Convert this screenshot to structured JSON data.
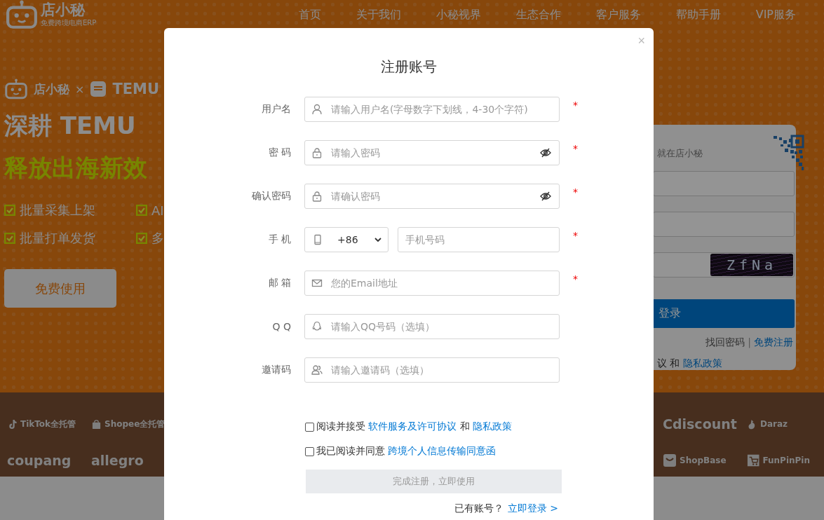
{
  "header": {
    "logo": {
      "name": "店小秘",
      "tagline": "免费跨境电商ERP"
    },
    "nav": [
      {
        "label": "首页"
      },
      {
        "label": "关于我们"
      },
      {
        "label": "小秘视界"
      },
      {
        "label": "生态合作"
      },
      {
        "label": "客户服务"
      },
      {
        "label": "帮助手册"
      },
      {
        "label": "VIP服务"
      }
    ]
  },
  "hero": {
    "brand": "店小秘",
    "cross": "×",
    "partner": "TEMU",
    "headline": "深耕 TEMU",
    "subheadline": "释放出海新效",
    "features": [
      {
        "label": "批量采集上架",
        "checked": true
      },
      {
        "label": "AI",
        "checked": true
      },
      {
        "label": "批量打单发货",
        "checked": true
      },
      {
        "label": "多",
        "checked": true
      }
    ],
    "primary_button": "免费使用"
  },
  "login_card": {
    "slogan": "就在店小秘",
    "captcha": "ZfNa",
    "login_button": "登录",
    "forgot_link": "找回密码",
    "separator": "|",
    "register_link": "免费注册",
    "agreement_text": "议 和",
    "privacy_link": "隐私政策"
  },
  "platforms": [
    {
      "kind": "tiktok",
      "name": "TikTok全托管"
    },
    {
      "kind": "shopee",
      "name": "Shopee全托管"
    },
    {
      "kind": "cdiscount",
      "name": "Cdiscount"
    },
    {
      "kind": "daraz",
      "name": "Daraz"
    },
    {
      "kind": "coupang",
      "name": "coupang"
    },
    {
      "kind": "allegro",
      "name": "allegro"
    },
    {
      "kind": "shopbase",
      "name": "ShopBase"
    },
    {
      "kind": "funpinpin",
      "name": "FunPinPin"
    }
  ],
  "register_dialog": {
    "title": "注册账号",
    "close": "×",
    "required_mark": "*",
    "fields": [
      {
        "kind": "username",
        "label": "用户名",
        "placeholder": "请输入用户名(字母数字下划线，4-30个字符)",
        "required": true
      },
      {
        "kind": "password",
        "label": "密 码",
        "placeholder": "请输入密码",
        "required": true
      },
      {
        "kind": "password",
        "label": "确认密码",
        "placeholder": "请确认密码",
        "required": true
      },
      {
        "kind": "phone",
        "label": "手 机",
        "country_code": "+86",
        "placeholder": "手机号码",
        "required": true
      },
      {
        "kind": "email",
        "label": "邮 箱",
        "placeholder": "您的Email地址",
        "required": true
      },
      {
        "kind": "qq",
        "label": "Q Q",
        "placeholder": "请输入QQ号码（选填）",
        "required": false
      },
      {
        "kind": "invite",
        "label": "邀请码",
        "placeholder": "请输入邀请码（选填）",
        "required": false
      }
    ],
    "consents": [
      {
        "checked": false,
        "parts": [
          {
            "text": "阅读并接受"
          },
          {
            "link": "软件服务及许可协议"
          },
          {
            "text": "和"
          },
          {
            "link": "隐私政策"
          }
        ]
      },
      {
        "checked": false,
        "parts": [
          {
            "text": "我已阅读并同意"
          },
          {
            "link": "跨境个人信息传输同意函"
          }
        ]
      }
    ],
    "submit": {
      "label": "完成注册，立即使用",
      "disabled": true
    },
    "footer": {
      "text": "已有账号？",
      "link": "立即登录 >"
    }
  }
}
